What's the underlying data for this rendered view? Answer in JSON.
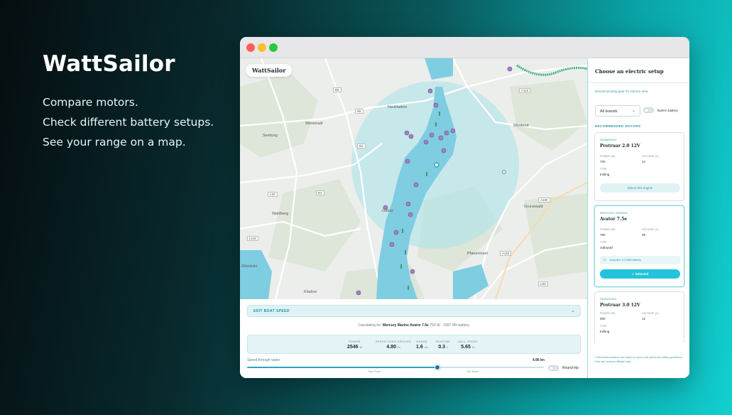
{
  "promo": {
    "title": "WattSailor",
    "lines": [
      "Compare motors.",
      "Check different battery setups.",
      "See your range on a map."
    ]
  },
  "map": {
    "logo": "WattSailor",
    "place_labels": [
      "Seeburg",
      "Wahlberg",
      "Gatow",
      "Glienicke",
      "Weststadt",
      "Westend",
      "Kladow",
      "Grunewald",
      "Neukladow",
      "Pfaueninsel"
    ],
    "road_labels": [
      "B5",
      "B5",
      "B2",
      "B2",
      "L20",
      "A100",
      "A115",
      "L90",
      "A115",
      "L115"
    ],
    "colors": {
      "water": "#7fcde0",
      "range_circle": "#a9e3eb",
      "green_area": "#dbe7d6"
    }
  },
  "bottom": {
    "boat_speed_header": "EDIT BOAT SPEED",
    "calc_prefix": "Calculating for:",
    "calc_model": "Mercury Marine Avator 7.5e",
    "calc_rest": "750 W · 1097 Wh battery",
    "stats": [
      {
        "key": "POWER",
        "value": "2546",
        "unit": "W"
      },
      {
        "key": "SPEED OVER GROUND",
        "value": "4.80",
        "unit": "kn"
      },
      {
        "key": "RANGE",
        "value": "1.6",
        "unit": "nm"
      },
      {
        "key": "RUNTIME",
        "value": "0.3",
        "unit": "h"
      },
      {
        "key": "HULL SPEED",
        "value": "5.65",
        "unit": "kn"
      }
    ],
    "speed_label": "Speed through water",
    "speed_value": "4.96 kn",
    "speed_fraction": 0.64,
    "tick_labels": [
      "Max Power",
      "Hull Speed"
    ],
    "round_trip": "Round trip"
  },
  "panel": {
    "title": "Choose an electric setup",
    "subtitle": "Recommending gear for inshore area",
    "brand_select": "All brands",
    "builtin_battery": "Built-in battery",
    "recommended_title": "RECOMMENDED MOTORS",
    "cards": [
      {
        "brand": "HAIBARING",
        "name": "Protruar 2.0 12V",
        "power_key": "POWER (W)",
        "power": "720",
        "voltage_key": "VOLTAGE (V)",
        "voltage": "12",
        "type_key": "TYPE",
        "type": "trolling",
        "button": "Select this engine"
      },
      {
        "brand": "MERCURY MARINE",
        "name": "Avator 7.5e",
        "power_key": "POWER (W)",
        "power": "750",
        "voltage_key": "VOLTAGE (V)",
        "voltage": "48",
        "type_key": "TYPE",
        "type": "outboard",
        "includes": "Includes 1.0 kWh battery",
        "button": "✓ Selected"
      },
      {
        "brand": "HAIBARING",
        "name": "Protruar 3.0 12V",
        "power_key": "POWER (W)",
        "power": "900",
        "voltage_key": "VOLTAGE (V)",
        "voltage": "12",
        "type_key": "TYPE",
        "type": "trolling"
      }
    ],
    "footnote": "** Recommendations are based on your boat specs and safety guidelines. Links are amazon affiliate links."
  }
}
